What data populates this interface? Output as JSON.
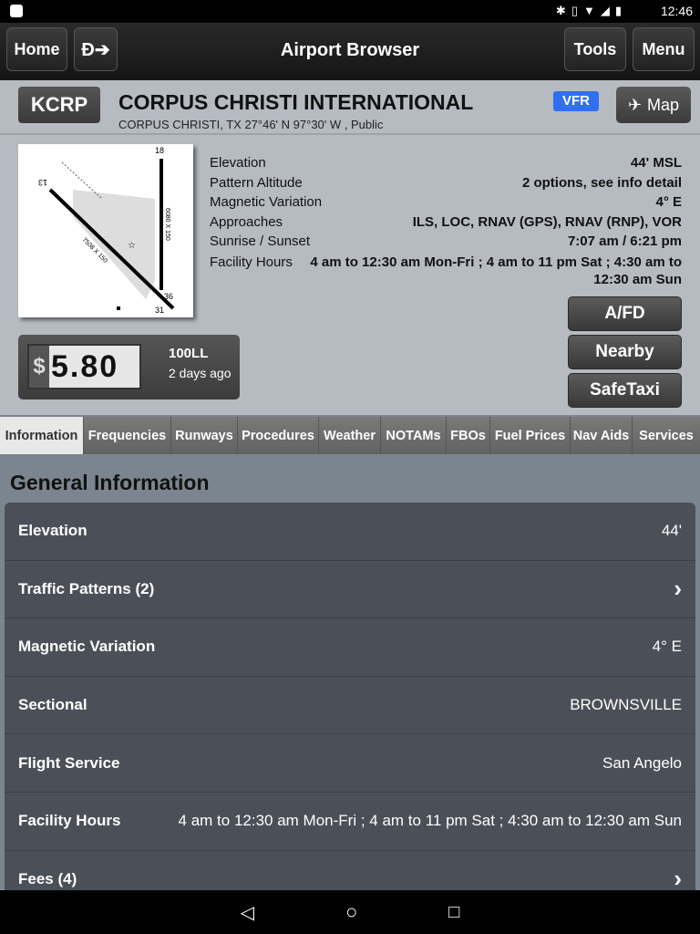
{
  "status_bar": {
    "time": "12:46",
    "icons": [
      "bluetooth-icon",
      "vibrate-icon",
      "wifi-icon",
      "signal-icon",
      "battery-icon"
    ]
  },
  "header": {
    "home": "Home",
    "title": "Airport Browser",
    "tools": "Tools",
    "menu": "Menu"
  },
  "airport": {
    "ident": "KCRP",
    "name": "CORPUS CHRISTI INTERNATIONAL",
    "location": "CORPUS CHRISTI, TX 27°46' N 97°30' W , Public",
    "flight_rules": "VFR",
    "flight_rules_color": "#2f6ff0",
    "map": "Map",
    "diagram": {
      "rwy_13": "13",
      "rwy_31": "31",
      "rwy_18": "18",
      "rwy_36": "36",
      "len_13_31": "7508 X 150",
      "len_18_36": "6080 X 150"
    },
    "facts": [
      {
        "label": "Elevation",
        "value": "44' MSL"
      },
      {
        "label": "Pattern Altitude",
        "value": "2 options, see info detail"
      },
      {
        "label": "Magnetic Variation",
        "value": "4° E"
      },
      {
        "label": "Approaches",
        "value": "ILS, LOC, RNAV (GPS), RNAV (RNP), VOR"
      },
      {
        "label": "Sunrise / Sunset",
        "value": "7:07 am /  6:21 pm"
      },
      {
        "label": "Facility Hours",
        "value": "4 am to 12:30 am Mon-Fri ; 4 am to 11 pm Sat ; 4:30 am to 12:30 am Sun"
      }
    ],
    "buttons": {
      "afd": "A/FD",
      "nearby": "Nearby",
      "safetaxi": "SafeTaxi"
    },
    "fuel": {
      "currency": "$",
      "price": "5.80",
      "type": "100LL",
      "age": "2 days ago"
    }
  },
  "tabs": [
    "Information",
    "Frequencies",
    "Runways",
    "Procedures",
    "Weather",
    "NOTAMs",
    "FBOs",
    "Fuel Prices",
    "Nav Aids",
    "Services"
  ],
  "section_title": "General Information",
  "rows": [
    {
      "label": "Elevation",
      "value": "44'"
    },
    {
      "label": "Traffic Patterns (2)",
      "value": "›"
    },
    {
      "label": "Magnetic Variation",
      "value": "4° E"
    },
    {
      "label": "Sectional",
      "value": "BROWNSVILLE"
    },
    {
      "label": "Flight Service",
      "value": "San Angelo"
    },
    {
      "label": "Facility Hours",
      "value": "4 am to 12:30 am Mon-Fri ; 4 am to 11 pm Sat ; 4:30 am to 12:30 am Sun"
    },
    {
      "label": "Fees (4)",
      "value": "›"
    }
  ]
}
